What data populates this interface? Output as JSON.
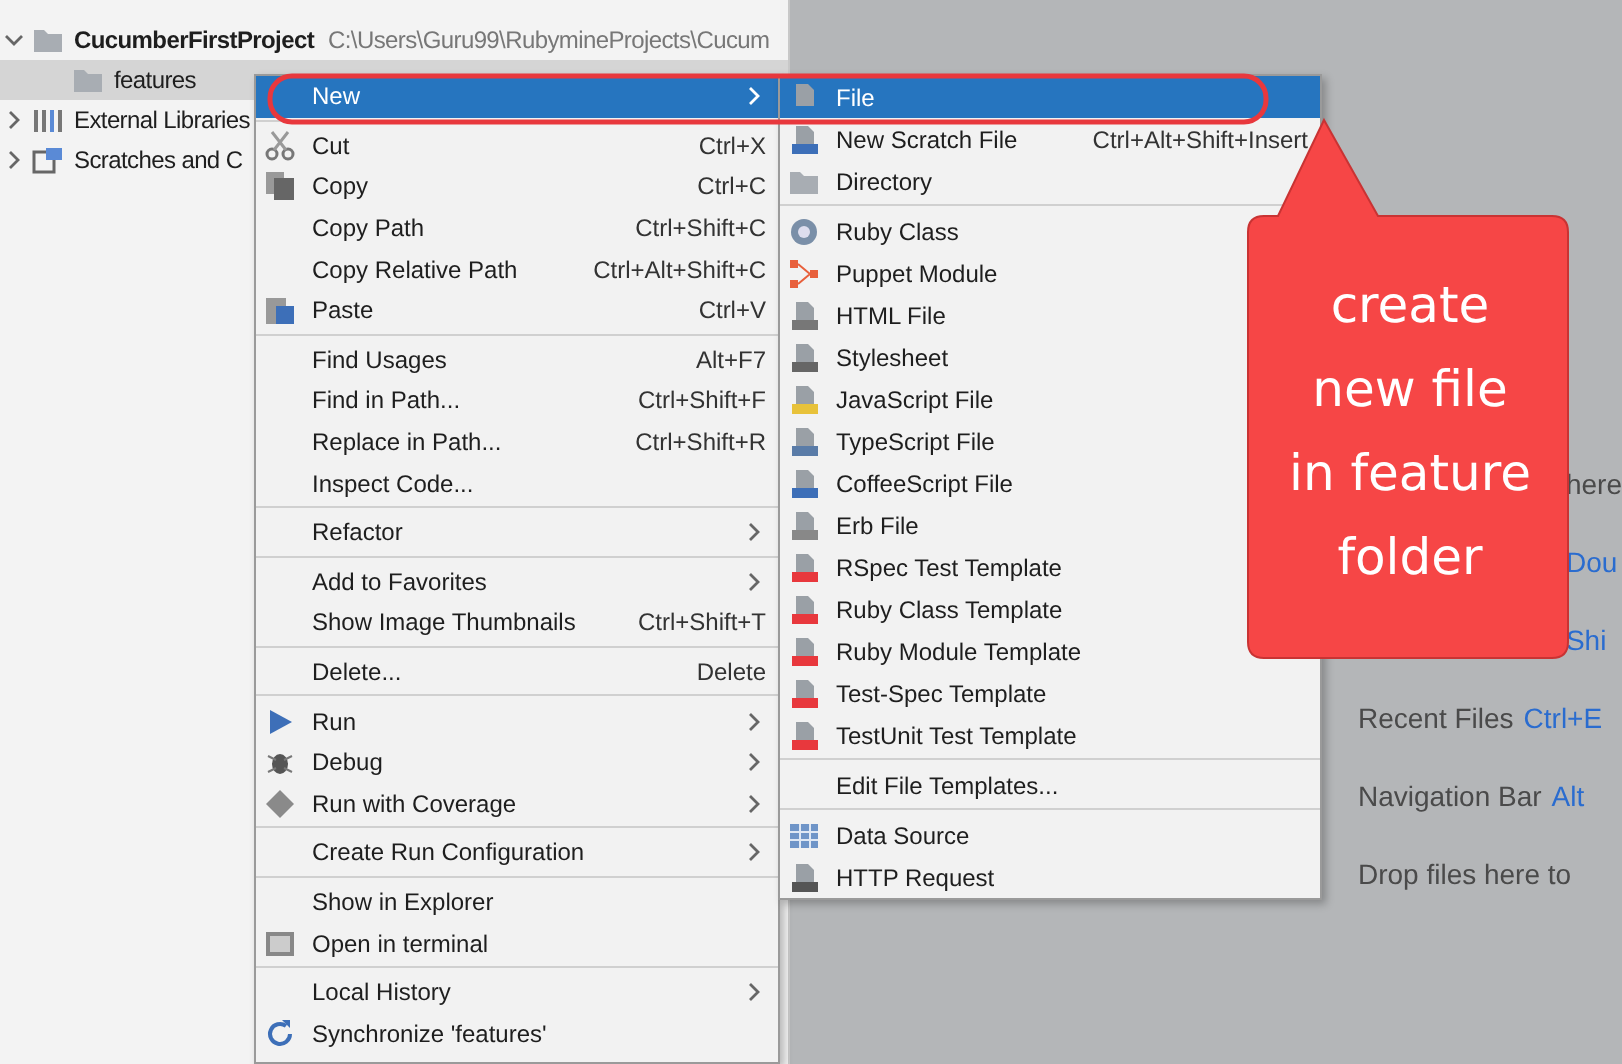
{
  "project_tree": [
    {
      "label": "CucumberFirstProject",
      "path": "C:\\Users\\Guru99\\RubymineProjects\\Cucum",
      "kind": "folder",
      "expanded": true,
      "selected": false,
      "bold": true,
      "children": [
        {
          "label": "features",
          "kind": "folder",
          "selected": true
        }
      ]
    },
    {
      "label": "External Libraries",
      "kind": "library",
      "expanded": false,
      "selected": false
    },
    {
      "label": "Scratches and C",
      "kind": "scratch",
      "expanded": false,
      "selected": false
    }
  ],
  "context_menu": [
    [
      {
        "label": "New",
        "submenu": true,
        "selected": true
      }
    ],
    [
      {
        "label": "Cut",
        "shortcut": "Ctrl+X",
        "kind": "scissors",
        "selected": false
      },
      {
        "label": "Copy",
        "shortcut": "Ctrl+C",
        "kind": "copy",
        "selected": false
      },
      {
        "label": "Copy Path",
        "shortcut": "Ctrl+Shift+C",
        "selected": false
      },
      {
        "label": "Copy Relative Path",
        "shortcut": "Ctrl+Alt+Shift+C",
        "selected": false
      },
      {
        "label": "Paste",
        "shortcut": "Ctrl+V",
        "kind": "paste",
        "selected": false
      }
    ],
    [
      {
        "label": "Find Usages",
        "shortcut": "Alt+F7",
        "selected": false
      },
      {
        "label": "Find in Path...",
        "shortcut": "Ctrl+Shift+F",
        "selected": false
      },
      {
        "label": "Replace in Path...",
        "shortcut": "Ctrl+Shift+R",
        "selected": false
      },
      {
        "label": "Inspect Code...",
        "selected": false
      }
    ],
    [
      {
        "label": "Refactor",
        "submenu": true,
        "selected": false
      }
    ],
    [
      {
        "label": "Add to Favorites",
        "submenu": true,
        "selected": false
      },
      {
        "label": "Show Image Thumbnails",
        "shortcut": "Ctrl+Shift+T",
        "selected": false
      }
    ],
    [
      {
        "label": "Delete...",
        "shortcut": "Delete",
        "selected": false
      }
    ],
    [
      {
        "label": "Run",
        "submenu": true,
        "kind": "run",
        "selected": false
      },
      {
        "label": "Debug",
        "submenu": true,
        "kind": "debug",
        "selected": false
      },
      {
        "label": "Run with Coverage",
        "submenu": true,
        "kind": "coverage",
        "selected": false
      }
    ],
    [
      {
        "label": "Create Run Configuration",
        "submenu": true,
        "selected": false
      }
    ],
    [
      {
        "label": "Show in Explorer",
        "selected": false
      },
      {
        "label": "Open in terminal",
        "kind": "terminal",
        "selected": false
      }
    ],
    [
      {
        "label": "Local History",
        "submenu": true,
        "selected": false
      },
      {
        "label": "Synchronize 'features'",
        "kind": "sync",
        "selected": false
      }
    ]
  ],
  "new_submenu": [
    [
      {
        "label": "File",
        "kind": "file",
        "selected": true
      },
      {
        "label": "New Scratch File",
        "shortcut": "Ctrl+Alt+Shift+Insert",
        "kind": "scratch-file",
        "selected": false
      },
      {
        "label": "Directory",
        "kind": "folder",
        "selected": false
      }
    ],
    [
      {
        "label": "Ruby Class",
        "kind": "ruby-class",
        "selected": false
      },
      {
        "label": "Puppet Module",
        "kind": "puppet",
        "selected": false
      },
      {
        "label": "HTML File",
        "kind": "html",
        "selected": false
      },
      {
        "label": "Stylesheet",
        "kind": "css",
        "selected": false
      },
      {
        "label": "JavaScript File",
        "kind": "js",
        "selected": false
      },
      {
        "label": "TypeScript File",
        "kind": "ts",
        "selected": false
      },
      {
        "label": "CoffeeScript File",
        "kind": "coffee",
        "selected": false
      },
      {
        "label": "Erb File",
        "kind": "erb",
        "selected": false
      },
      {
        "label": "RSpec Test Template",
        "kind": "template",
        "selected": false
      },
      {
        "label": "Ruby Class Template",
        "kind": "template",
        "selected": false
      },
      {
        "label": "Ruby Module Template",
        "kind": "template",
        "selected": false
      },
      {
        "label": "Test-Spec Template",
        "kind": "template",
        "selected": false
      },
      {
        "label": "TestUnit Test Template",
        "kind": "template",
        "selected": false
      }
    ],
    [
      {
        "label": "Edit File Templates...",
        "selected": false
      }
    ],
    [
      {
        "label": "Data Source",
        "kind": "datasource",
        "selected": false
      },
      {
        "label": "HTTP Request",
        "kind": "api",
        "selected": false
      }
    ]
  ],
  "callout": {
    "lines": [
      "create",
      "new file",
      "in feature",
      "folder"
    ]
  },
  "editor_hints": [
    {
      "label": "here",
      "partial": true
    },
    {
      "shortcut": "Dou",
      "partial": true
    },
    {
      "shortcut": "Shi",
      "partial": true
    },
    {
      "label": "Recent Files",
      "shortcut": "Ctrl+E"
    },
    {
      "label": "Navigation Bar",
      "shortcut": "Alt"
    },
    {
      "label": "Drop files here to"
    }
  ]
}
